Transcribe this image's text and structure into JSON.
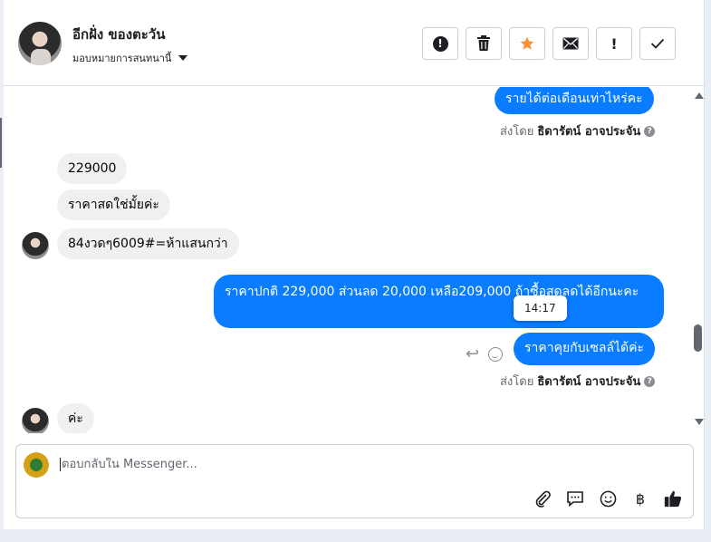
{
  "header": {
    "contact_name": "อีกฝั่ง ของตะวัน",
    "assign_label": "มอบหมายการสนทนานี้",
    "actions": [
      {
        "name": "spam-button",
        "icon": "exclamation-circle-icon"
      },
      {
        "name": "delete-button",
        "icon": "trash-icon"
      },
      {
        "name": "star-button",
        "icon": "star-icon",
        "color": "#f7923a"
      },
      {
        "name": "mark-unread-button",
        "icon": "envelope-icon"
      },
      {
        "name": "follow-up-button",
        "icon": "exclamation-icon",
        "label": "!"
      },
      {
        "name": "done-button",
        "icon": "check-icon"
      }
    ]
  },
  "messages": {
    "m1": "รายได้ต่อเดือนเท่าไหร่คะ",
    "sent_by_label": "ส่งโดย",
    "sent_by_name": "ธิดารัตน์ อาจประจัน",
    "m2": "229000",
    "m3": "ราคาสดใช่มั้ยค่ะ",
    "m4": "84งวดๆ6009#=ห้าแสนกว่า",
    "m5": "ราคาปกติ 229,000 ส่วนลด 20,000 เหลือ209,000 ถ้าซื้อสดลดได้อีกนะคะ",
    "tooltip_time": "14:17",
    "m6": "ราคาคุยกับเซลล์ได้ค่ะ",
    "m7": "ค่ะ"
  },
  "composer": {
    "placeholder": "ตอบกลับใน Messenger..."
  },
  "colors": {
    "outgoing": "#0a7cff",
    "incoming": "#f0f0f0",
    "accent_star": "#f7923a"
  }
}
